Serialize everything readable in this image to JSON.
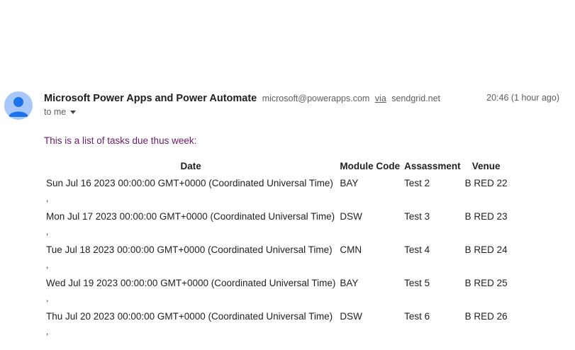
{
  "email": {
    "sender_name": "Microsoft Power Apps and Power Automate",
    "sender_email": "microsoft@powerapps.com",
    "via_label": "via",
    "via_domain": "sendgrid.net",
    "recipient": "to me",
    "timestamp": "20:46 (1 hour ago)",
    "intro": "This is a list of tasks due thus week:",
    "avatar_color": "#a8c7fa",
    "avatar_icon": "person-icon"
  },
  "table": {
    "headers": {
      "date": "Date",
      "module": "Module Code",
      "assessment": "Assassment",
      "venue": "Venue"
    },
    "separator": ",",
    "rows": [
      {
        "date": "Sun Jul 16 2023 00:00:00 GMT+0000 (Coordinated Universal Time)",
        "module": "BAY",
        "assessment": "Test 2",
        "venue": "B RED 22"
      },
      {
        "date": "Mon Jul 17 2023 00:00:00 GMT+0000 (Coordinated Universal Time)",
        "module": "DSW",
        "assessment": "Test 3",
        "venue": "B RED 23"
      },
      {
        "date": "Tue Jul 18 2023 00:00:00 GMT+0000 (Coordinated Universal Time)",
        "module": "CMN",
        "assessment": "Test 4",
        "venue": "B RED 24"
      },
      {
        "date": "Wed Jul 19 2023 00:00:00 GMT+0000 (Coordinated Universal Time)",
        "module": "BAY",
        "assessment": "Test 5",
        "venue": "B RED 25"
      },
      {
        "date": "Thu Jul 20 2023 00:00:00 GMT+0000 (Coordinated Universal Time)",
        "module": "DSW",
        "assessment": "Test 6",
        "venue": "B RED 26"
      }
    ]
  }
}
